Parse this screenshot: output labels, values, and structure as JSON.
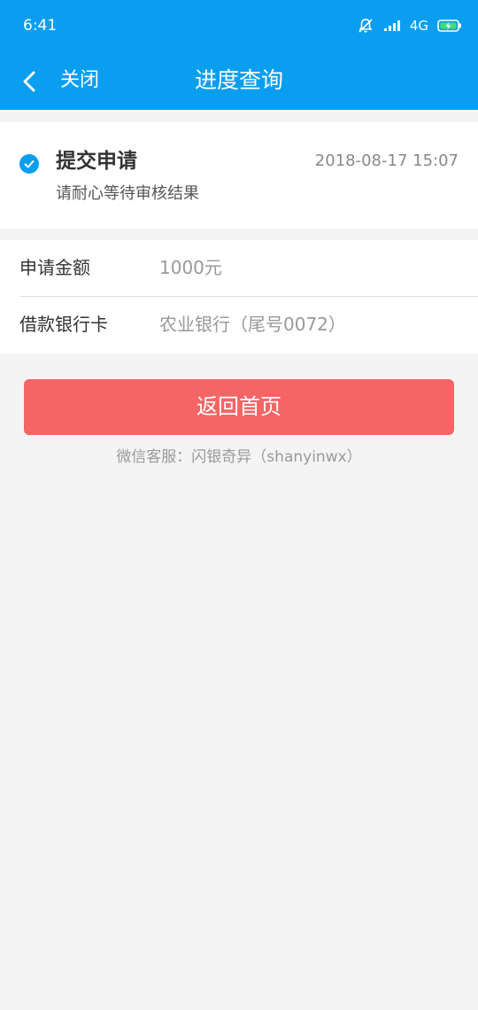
{
  "status_bar": {
    "time": "6:41",
    "network": "4G"
  },
  "header": {
    "close_label": "关闭",
    "title": "进度查询"
  },
  "progress": {
    "step_title": "提交申请",
    "step_time": "2018-08-17 15:07",
    "step_desc": "请耐心等待审核结果"
  },
  "info": {
    "rows": [
      {
        "label": "申请金额",
        "value": "1000元"
      },
      {
        "label": "借款银行卡",
        "value": "农业银行（尾号0072）"
      }
    ]
  },
  "actions": {
    "home_label": "返回首页"
  },
  "footer": {
    "service_text": "微信客服：闪银奇异（shanyinwx）"
  },
  "colors": {
    "primary_blue": "#0a9ef0",
    "button_red": "#f56566",
    "background": "#f4f4f4"
  }
}
